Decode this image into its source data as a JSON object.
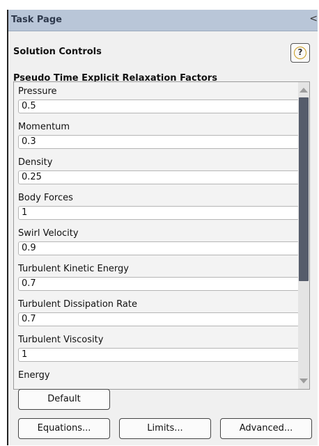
{
  "task_page": {
    "title": "Task Page",
    "collapse_glyph": "<"
  },
  "panel": {
    "title": "Solution Controls",
    "help_icon": "help-icon",
    "help_glyph": "?"
  },
  "group": {
    "title": "Pseudo Time Explicit Relaxation Factors",
    "fields": [
      {
        "label": "Pressure",
        "value": "0.5"
      },
      {
        "label": "Momentum",
        "value": "0.3"
      },
      {
        "label": "Density",
        "value": "0.25"
      },
      {
        "label": "Body Forces",
        "value": "1"
      },
      {
        "label": "Swirl Velocity",
        "value": "0.9"
      },
      {
        "label": "Turbulent Kinetic Energy",
        "value": "0.7"
      },
      {
        "label": "Turbulent Dissipation Rate",
        "value": "0.7"
      },
      {
        "label": "Turbulent Viscosity",
        "value": "1"
      },
      {
        "label": "Energy",
        "value": ""
      }
    ]
  },
  "buttons": {
    "default": "Default",
    "equations": "Equations...",
    "limits": "Limits...",
    "advanced": "Advanced..."
  },
  "colors": {
    "titlebar_bg": "#b9c6d8",
    "panel_bg": "#f0f0f0",
    "scroll_thumb": "#555c6b",
    "help_ring": "#c89a1a"
  }
}
